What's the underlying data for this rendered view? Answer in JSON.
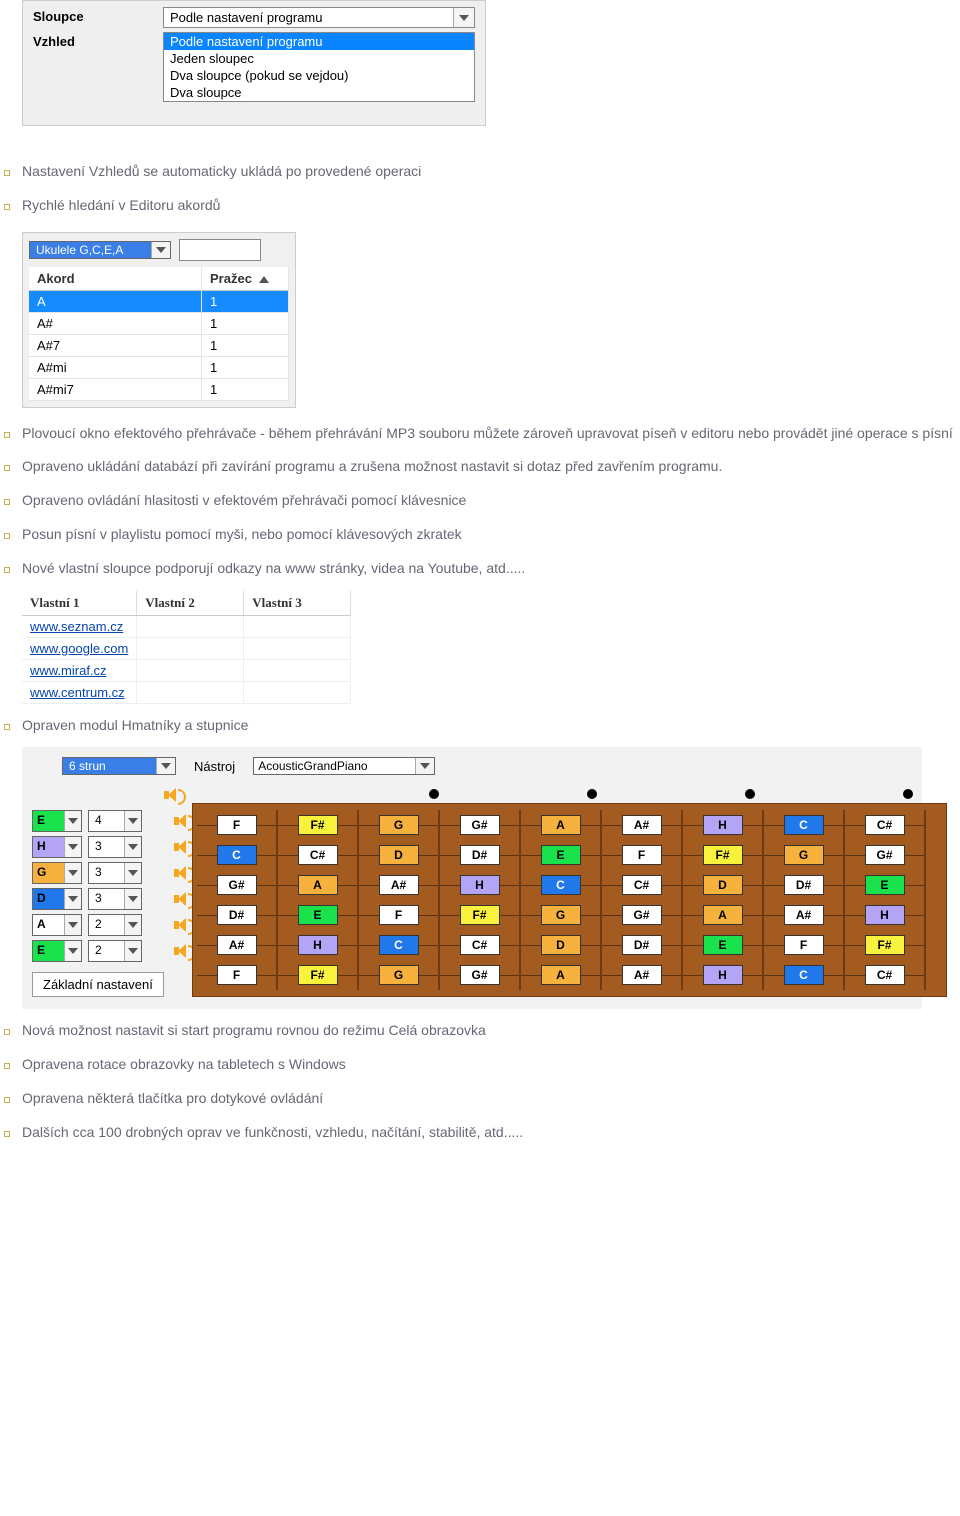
{
  "settings_panel": {
    "sloupce_label": "Sloupce",
    "vzhled_label": "Vzhled",
    "selected": "Podle nastavení programu",
    "options": [
      "Podle nastavení programu",
      "Jeden sloupec",
      "Dva sloupce (pokud se vejdou)",
      "Dva sloupce"
    ]
  },
  "bullets1": [
    "Nastavení Vzhledů se automaticky ukládá po provedené operaci",
    "Rychlé hledání v Editoru akordů"
  ],
  "akord_panel": {
    "tuning": "Ukulele  G,C,E,A",
    "header_akord": "Akord",
    "header_prazec": "Pražec",
    "rows": [
      {
        "a": "A",
        "p": "1",
        "sel": true
      },
      {
        "a": "A#",
        "p": "1"
      },
      {
        "a": "A#7",
        "p": "1"
      },
      {
        "a": "A#mi",
        "p": "1"
      },
      {
        "a": "A#mi7",
        "p": "1"
      }
    ]
  },
  "bullets2": [
    "Plovoucí okno efektového přehrávače - během přehrávání MP3 souboru můžete zároveň upravovat píseň v editoru nebo provádět jiné operace s písní",
    "Opraveno ukládání databází při zavírání programu a zrušena možnost nastavit si dotaz před zavřením programu.",
    "Opraveno ovládání hlasitosti v efektovém přehrávači pomocí klávesnice",
    "Posun písní v playlistu pomocí myši, nebo pomocí klávesových zkratek",
    "Nové vlastní sloupce podporují odkazy na www stránky, videa na Youtube, atd....."
  ],
  "vlastni": {
    "headers": [
      "Vlastní 1",
      "Vlastní 2",
      "Vlastní 3"
    ],
    "rows": [
      "www.seznam.cz",
      "www.google.com",
      "www.miraf.cz",
      "www.centrum.cz"
    ]
  },
  "bullets3": [
    "Opraven modul Hmatníky a stupnice"
  ],
  "fret_panel": {
    "strings_label": "6 strun",
    "nastroj_label": "Nástroj",
    "instrument": "AcousticGrandPiano",
    "basic_btn": "Základní nastavení",
    "tunings": [
      {
        "note": "E",
        "num": "4",
        "color": "c-green"
      },
      {
        "note": "H",
        "num": "3",
        "color": "c-purple"
      },
      {
        "note": "G",
        "num": "3",
        "color": "c-orange"
      },
      {
        "note": "D",
        "num": "3",
        "color": "c-blue"
      },
      {
        "note": "A",
        "num": "2",
        "color": "c-white"
      },
      {
        "note": "E",
        "num": "2",
        "color": "c-green"
      }
    ],
    "board": [
      [
        {
          "t": "F",
          "c": "c-white"
        },
        {
          "t": "F#",
          "c": "c-yellow"
        },
        {
          "t": "G",
          "c": "c-orange"
        },
        {
          "t": "G#",
          "c": "c-white"
        },
        {
          "t": "A",
          "c": "c-orange"
        },
        {
          "t": "A#",
          "c": "c-white"
        },
        {
          "t": "H",
          "c": "c-purple"
        },
        {
          "t": "C",
          "c": "c-blue"
        },
        {
          "t": "C#",
          "c": "c-white"
        }
      ],
      [
        {
          "t": "C",
          "c": "c-blue"
        },
        {
          "t": "C#",
          "c": "c-white"
        },
        {
          "t": "D",
          "c": "c-orange"
        },
        {
          "t": "D#",
          "c": "c-white"
        },
        {
          "t": "E",
          "c": "c-green"
        },
        {
          "t": "F",
          "c": "c-white"
        },
        {
          "t": "F#",
          "c": "c-yellow"
        },
        {
          "t": "G",
          "c": "c-orange"
        },
        {
          "t": "G#",
          "c": "c-white"
        }
      ],
      [
        {
          "t": "G#",
          "c": "c-white"
        },
        {
          "t": "A",
          "c": "c-orange"
        },
        {
          "t": "A#",
          "c": "c-white"
        },
        {
          "t": "H",
          "c": "c-purple"
        },
        {
          "t": "C",
          "c": "c-blue"
        },
        {
          "t": "C#",
          "c": "c-white"
        },
        {
          "t": "D",
          "c": "c-orange"
        },
        {
          "t": "D#",
          "c": "c-white"
        },
        {
          "t": "E",
          "c": "c-green"
        }
      ],
      [
        {
          "t": "D#",
          "c": "c-white"
        },
        {
          "t": "E",
          "c": "c-green"
        },
        {
          "t": "F",
          "c": "c-white"
        },
        {
          "t": "F#",
          "c": "c-yellow"
        },
        {
          "t": "G",
          "c": "c-orange"
        },
        {
          "t": "G#",
          "c": "c-white"
        },
        {
          "t": "A",
          "c": "c-orange"
        },
        {
          "t": "A#",
          "c": "c-white"
        },
        {
          "t": "H",
          "c": "c-purple"
        }
      ],
      [
        {
          "t": "A#",
          "c": "c-white"
        },
        {
          "t": "H",
          "c": "c-purple"
        },
        {
          "t": "C",
          "c": "c-blue"
        },
        {
          "t": "C#",
          "c": "c-white"
        },
        {
          "t": "D",
          "c": "c-orange"
        },
        {
          "t": "D#",
          "c": "c-white"
        },
        {
          "t": "E",
          "c": "c-green"
        },
        {
          "t": "F",
          "c": "c-white"
        },
        {
          "t": "F#",
          "c": "c-yellow"
        }
      ],
      [
        {
          "t": "F",
          "c": "c-white"
        },
        {
          "t": "F#",
          "c": "c-yellow"
        },
        {
          "t": "G",
          "c": "c-orange"
        },
        {
          "t": "G#",
          "c": "c-white"
        },
        {
          "t": "A",
          "c": "c-orange"
        },
        {
          "t": "A#",
          "c": "c-white"
        },
        {
          "t": "H",
          "c": "c-purple"
        },
        {
          "t": "C",
          "c": "c-blue"
        },
        {
          "t": "C#",
          "c": "c-white"
        }
      ]
    ],
    "dot_positions": [
      2,
      4,
      6,
      8
    ]
  },
  "bullets4": [
    "Nová možnost nastavit si start programu rovnou do režimu Celá obrazovka",
    "Opravena rotace obrazovky na tabletech s Windows",
    "Opravena některá tlačítka pro dotykové ovládání",
    "Dalších cca 100 drobných oprav ve funkčnosti, vzhledu, načítání, stabilitě, atd....."
  ]
}
